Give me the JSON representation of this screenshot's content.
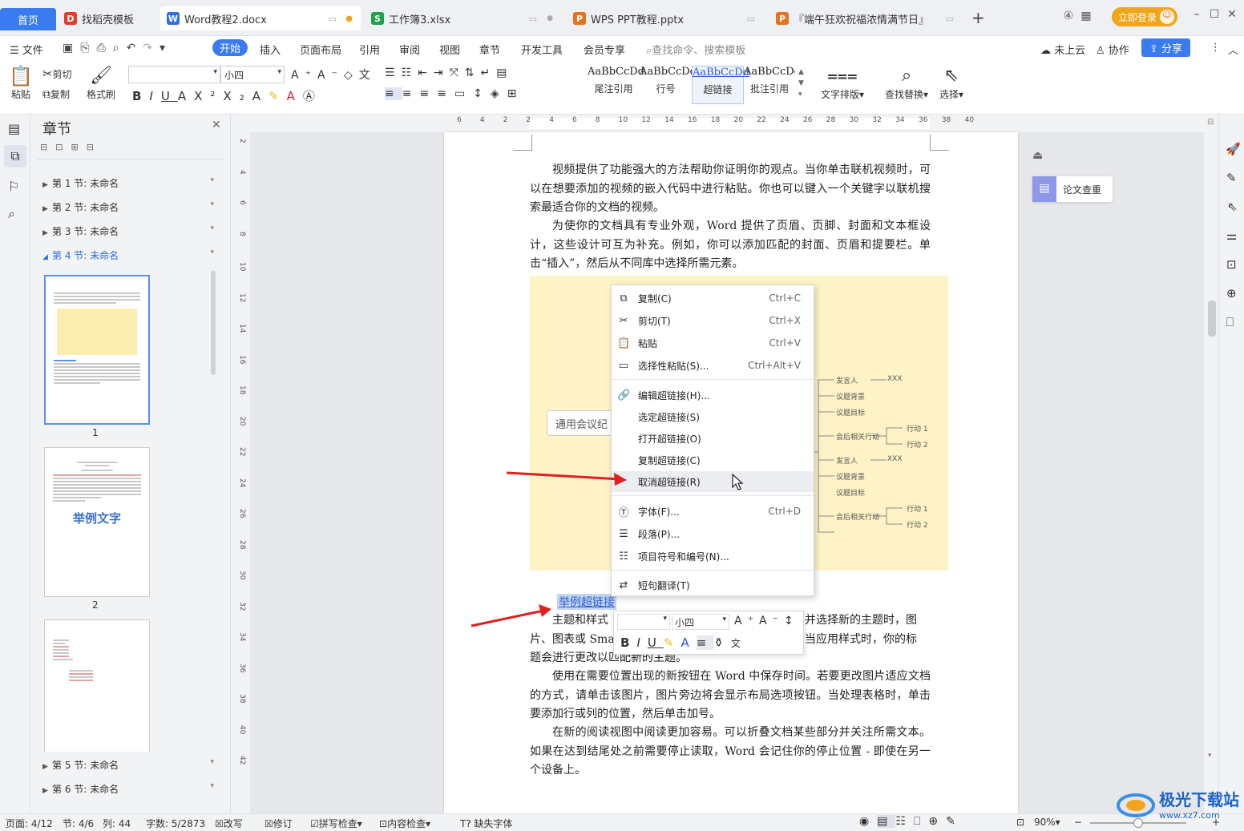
{
  "tabs": {
    "home": "首页",
    "items": [
      {
        "label": "找稻壳模板",
        "color": "#e63b2e",
        "icon": "D"
      },
      {
        "label": "Word教程2.docx",
        "color": "#2f6fe4",
        "icon": "W"
      },
      {
        "label": "工作簿3.xlsx",
        "color": "#1aa34a",
        "icon": "S"
      },
      {
        "label": "WPS PPT教程.pptx",
        "color": "#e8711c",
        "icon": "P"
      },
      {
        "label": "『端午狂欢祝福浓情满节日』",
        "color": "#e8711c",
        "icon": "P"
      }
    ],
    "login": "立即登录"
  },
  "menu": {
    "file": "文件",
    "items": [
      "开始",
      "插入",
      "页面布局",
      "引用",
      "审阅",
      "视图",
      "章节",
      "开发工具",
      "会员专享"
    ],
    "search": "查找命令、搜索模板",
    "cloud": "未上云",
    "collab": "协作",
    "share": "分享"
  },
  "ribbon": {
    "paste": "粘贴",
    "cut": "剪切",
    "copy": "复制",
    "format_painter": "格式刷",
    "font_size": "小四",
    "styles": [
      {
        "sample": "AaBbCcDd",
        "label": "尾注引用"
      },
      {
        "sample": "AaBbCcDd",
        "label": "行号"
      },
      {
        "sample": "AaBbCcDd",
        "label": "超链接"
      },
      {
        "sample": "AaBbCcDd",
        "label": "批注引用"
      }
    ],
    "text_layout": "文字排版",
    "find_replace": "查找替换",
    "select": "选择"
  },
  "chapter_panel": {
    "title": "章节",
    "sections": [
      "第 1 节: 未命名",
      "第 2 节: 未命名",
      "第 3 节: 未命名",
      "第 4 节: 未命名",
      "第 5 节: 未命名",
      "第 6 节: 未命名"
    ],
    "thumb2_heading": "举例文字",
    "page_numbers": [
      "1",
      "2"
    ]
  },
  "ruler": {
    "h_ticks": [
      "6",
      "4",
      "2",
      "2",
      "4",
      "6",
      "8",
      "10",
      "12",
      "14",
      "16",
      "18",
      "20",
      "22",
      "24",
      "26",
      "28",
      "30",
      "32",
      "34",
      "36",
      "38",
      "40"
    ],
    "v_ticks": [
      "2",
      "4",
      "6",
      "8",
      "10",
      "12",
      "14",
      "16",
      "18",
      "20",
      "22",
      "24",
      "26",
      "28",
      "30",
      "32",
      "34",
      "36",
      "38",
      "40",
      "42"
    ]
  },
  "document": {
    "p1": "视频提供了功能强大的方法帮助你证明你的观点。当你单击联机视频时，可以在想要添加的视频的嵌入代码中进行粘贴。你也可以键入一个关键字以联机搜索最适合你的文档的视频。",
    "p2": "为使你的文档具有专业外观，Word 提供了页眉、页脚、封面和文本框设计，这些设计可互为补充。例如，你可以添加匹配的封面、页眉和提要栏。单击“插入”，然后从不同库中选择所需元素。",
    "hyperlink": "举例超链接",
    "p3_line1": "主题和样式",
    "p3_line1_end": "并选择新的主题时，图",
    "p3_line2": "片、图表或 Sma",
    "p3_line2_end": "当应用样式时，你的标",
    "p3_line3": "题会进行更改以匹配新的主题。",
    "p4": "使用在需要位置出现的新按钮在 Word 中保存时间。若要更改图片适应文档的方式，请单击该图片，图片旁边将会显示布局选项按钮。当处理表格时，单击要添加行或列的位置，然后单击加号。",
    "p5": "在新的阅读视图中阅读更加容易。可以折叠文档某些部分并关注所需文本。如果在达到结尾处之前需要停止读取，Word 会记住你的停止位置 - 即使在另一个设备上。"
  },
  "diagram": {
    "center": "通用会议纪",
    "branch1": [
      "发言人",
      "XXX",
      "议题背景",
      "议题目标",
      "会后相关行动",
      "行动 1",
      "行动 2"
    ],
    "branch2": [
      "发言人",
      "XXX",
      "议题背景",
      "议题目标",
      "会后相关行动",
      "行动 1",
      "行动 2"
    ]
  },
  "context_menu": {
    "items": [
      {
        "label": "复制(C)",
        "shortcut": "Ctrl+C",
        "icon": "copy-icon"
      },
      {
        "label": "剪切(T)",
        "shortcut": "Ctrl+X",
        "icon": "scissors-icon"
      },
      {
        "label": "粘贴",
        "shortcut": "Ctrl+V",
        "icon": "paste-icon"
      },
      {
        "label": "选择性粘贴(S)...",
        "shortcut": "Ctrl+Alt+V",
        "icon": "paste-special-icon"
      },
      {
        "label": "编辑超链接(H)...",
        "shortcut": "",
        "icon": "link-icon"
      },
      {
        "label": "选定超链接(S)",
        "shortcut": "",
        "icon": ""
      },
      {
        "label": "打开超链接(O)",
        "shortcut": "",
        "icon": ""
      },
      {
        "label": "复制超链接(C)",
        "shortcut": "",
        "icon": ""
      },
      {
        "label": "取消超链接(R)",
        "shortcut": "",
        "icon": ""
      },
      {
        "label": "字体(F)...",
        "shortcut": "Ctrl+D",
        "icon": "font-icon"
      },
      {
        "label": "段落(P)...",
        "shortcut": "",
        "icon": "paragraph-icon"
      },
      {
        "label": "项目符号和编号(N)...",
        "shortcut": "",
        "icon": "list-icon"
      },
      {
        "label": "短句翻译(T)",
        "shortcut": "",
        "icon": "translate-icon"
      }
    ]
  },
  "mini_toolbar": {
    "font_size": "小四"
  },
  "plagiarism": "论文查重",
  "status": {
    "page": "页面: 4/12",
    "section": "节: 4/6",
    "column": "列: 44",
    "words": "字数: 5/2873",
    "revise": "改写",
    "track": "修订",
    "spell": "拼写检查",
    "content": "内容检查",
    "missing_font": "缺失字体",
    "zoom": "90%"
  },
  "watermark": {
    "brand": "极光下载站",
    "url": "www.xz7.com"
  },
  "colors": {
    "accent": "#3a7bf0",
    "login": "#f0a51a",
    "arrow": "#e01f1f"
  }
}
